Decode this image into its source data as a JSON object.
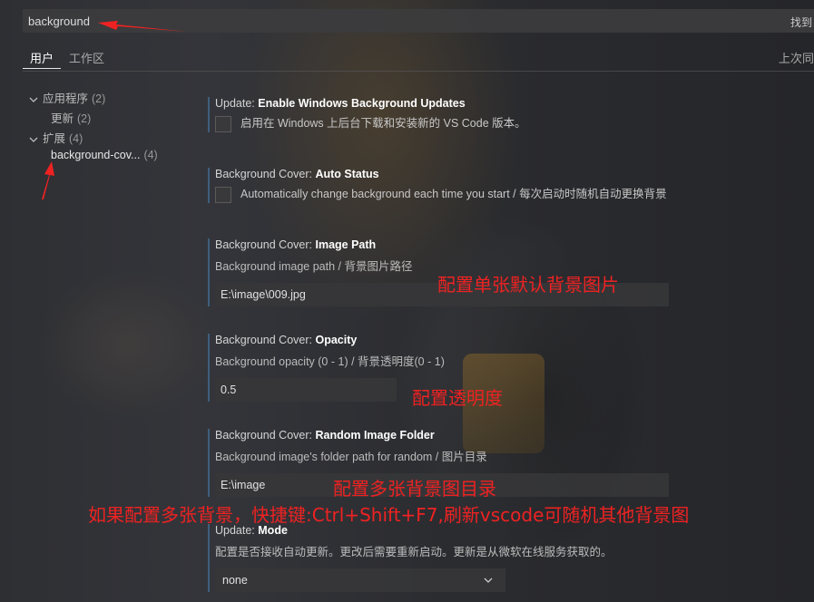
{
  "search": {
    "value": "background",
    "count_label": "找到"
  },
  "tabs": {
    "user": "用户",
    "workspace": "工作区",
    "right_label": "上次同"
  },
  "toc": [
    {
      "label": "应用程序",
      "count": "(2)"
    },
    {
      "label": "更新",
      "count": "(2)"
    },
    {
      "label": "扩展",
      "count": "(4)"
    },
    {
      "label": "background-cov...",
      "count": "(4)"
    }
  ],
  "settings": {
    "update_bg": {
      "category": "Update: ",
      "name": "Enable Windows Background Updates",
      "checkbox_label": "启用在 Windows 上后台下载和安装新的 VS Code 版本。"
    },
    "auto_status": {
      "category": "Background Cover: ",
      "name": "Auto Status",
      "checkbox_label": "Automatically change background each time you start / 每次启动时随机自动更换背景"
    },
    "image_path": {
      "category": "Background Cover: ",
      "name": "Image Path",
      "desc": "Background image path / 背景图片路径",
      "value": "E:\\image\\009.jpg"
    },
    "opacity": {
      "category": "Background Cover: ",
      "name": "Opacity",
      "desc": "Background opacity (0 - 1) / 背景透明度(0 - 1)",
      "value": "0.5"
    },
    "random_folder": {
      "category": "Background Cover: ",
      "name": "Random Image Folder",
      "desc": "Background image's folder path for random / 图片目录",
      "value": "E:\\image"
    },
    "mode": {
      "category": "Update: ",
      "name": "Mode",
      "desc": "配置是否接收自动更新。更改后需要重新启动。更新是从微软在线服务获取的。",
      "value": "none"
    }
  },
  "annotations": {
    "single_image": "配置单张默认背景图片",
    "opacity": "配置透明度",
    "multi_folder": "配置多张背景图目录",
    "hint": "如果配置多张背景，快捷键:Ctrl+Shift+F7,刷新vscode可随机其他背景图"
  },
  "colors": {
    "annotation": "#ee2222",
    "accent_border": "#4682b4"
  }
}
